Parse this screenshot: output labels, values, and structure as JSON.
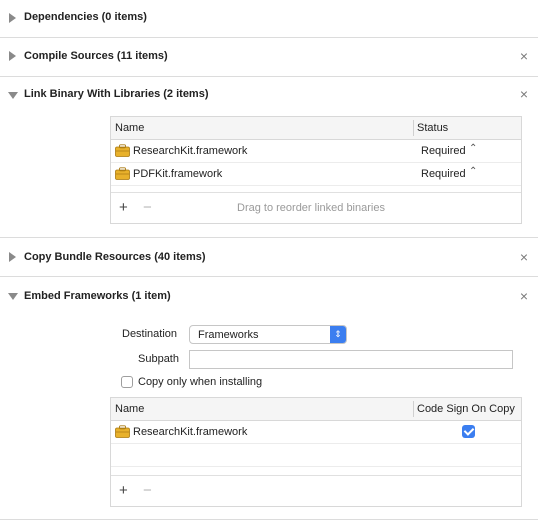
{
  "sections": [
    {
      "title": "Dependencies (0 items)",
      "expanded": false,
      "closable": false
    },
    {
      "title": "Compile Sources (11 items)",
      "expanded": false,
      "closable": true
    },
    {
      "title": "Link Binary With Libraries (2 items)",
      "expanded": true,
      "closable": true
    },
    {
      "title": "Copy Bundle Resources (40 items)",
      "expanded": false,
      "closable": true
    },
    {
      "title": "Embed Frameworks (1 item)",
      "expanded": true,
      "closable": true
    }
  ],
  "close_glyph": "×",
  "link_table": {
    "columns": [
      "Name",
      "Status"
    ],
    "rows": [
      {
        "name": "ResearchKit.framework",
        "status": "Required",
        "icon": "framework-icon"
      },
      {
        "name": "PDFKit.framework",
        "status": "Required",
        "icon": "framework-icon"
      }
    ],
    "footer_hint": "Drag to reorder linked binaries",
    "add_label": "+",
    "remove_label": "−"
  },
  "embed": {
    "destination_label": "Destination",
    "destination_value": "Frameworks",
    "subpath_label": "Subpath",
    "subpath_value": "",
    "copy_only_label": "Copy only when installing",
    "copy_only_checked": false,
    "table": {
      "columns": [
        "Name",
        "Code Sign On Copy"
      ],
      "rows": [
        {
          "name": "ResearchKit.framework",
          "code_sign": true,
          "icon": "framework-icon"
        }
      ],
      "add_label": "+",
      "remove_label": "−"
    }
  },
  "colors": {
    "accent": "#3b7ef0",
    "framework_icon": "#e8b12b"
  }
}
